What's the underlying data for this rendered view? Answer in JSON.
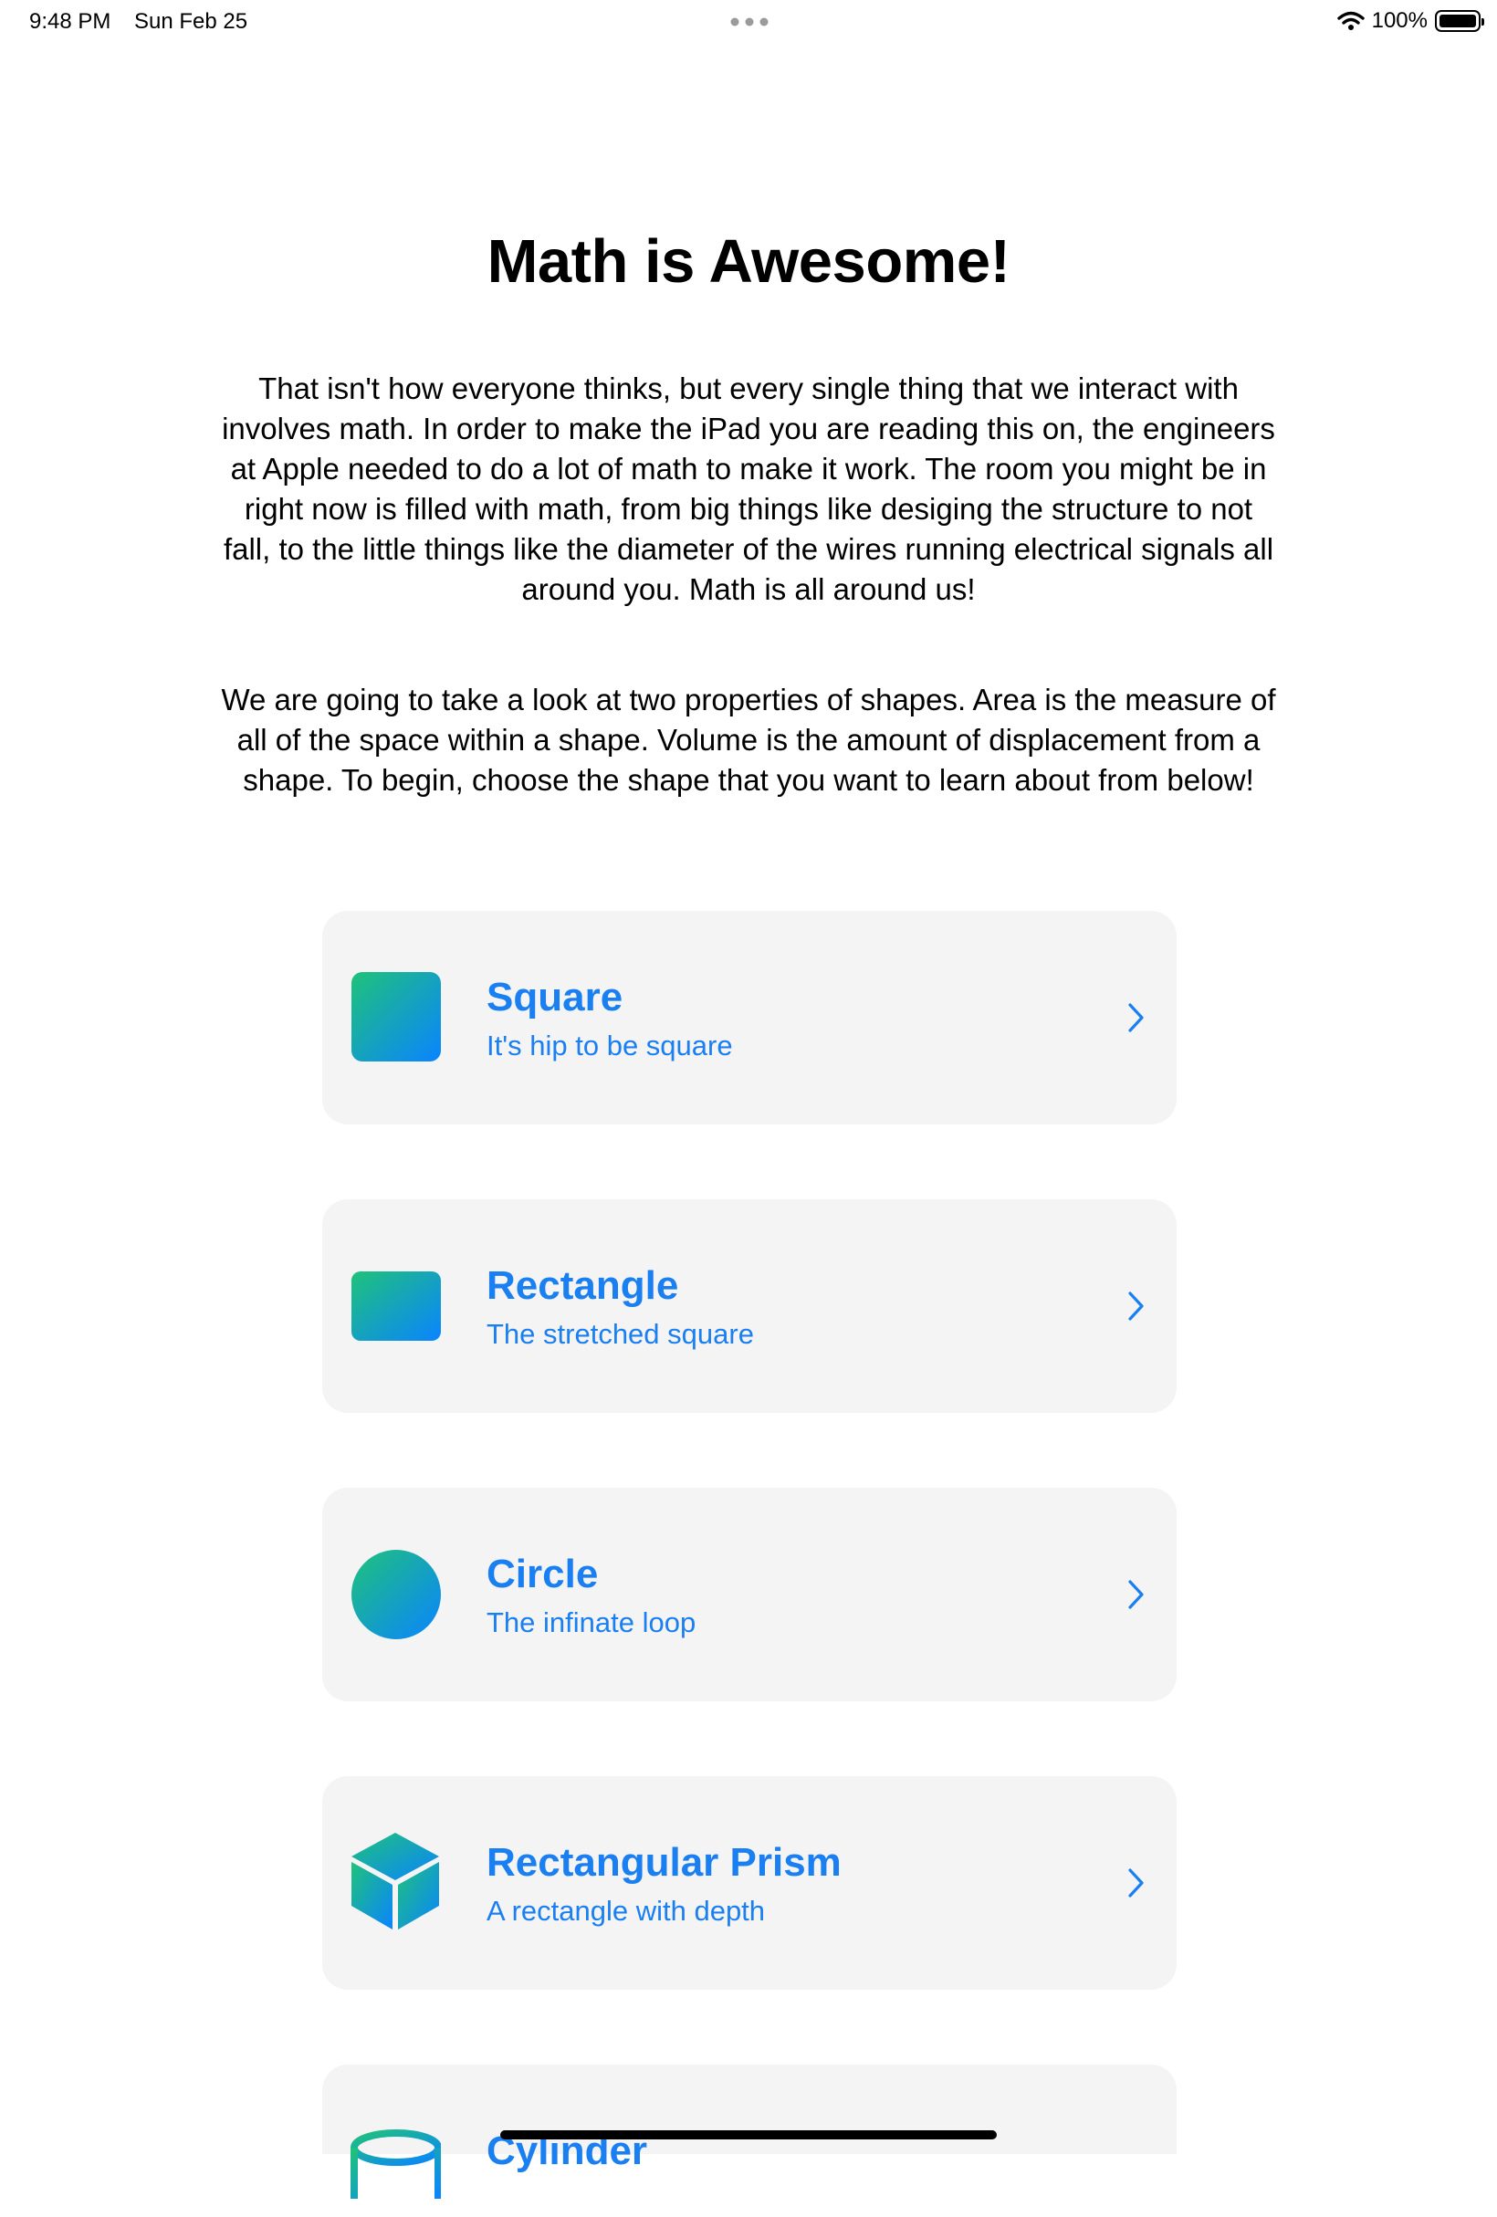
{
  "status_bar": {
    "time": "9:48 PM",
    "date": "Sun Feb 25",
    "battery": "100%"
  },
  "title": "Math is Awesome!",
  "intro": [
    "That isn't how everyone thinks, but every single thing that we interact with involves math. In order to make the iPad you are reading this on, the engineers at Apple needed to do a lot of math to make it work. The room you might be in right now is filled with math, from big things like desiging the structure to not fall, to the little things like the diameter of the wires running electrical signals all around you. Math is all around us!",
    "We are going to take a look at two properties of shapes. Area is the measure of all of the space within a shape. Volume is the amount of displacement from a shape. To begin, choose the shape that you want to learn about from below!"
  ],
  "shapes": [
    {
      "title": "Square",
      "subtitle": "It's hip to be square",
      "icon": "square-icon"
    },
    {
      "title": "Rectangle",
      "subtitle": "The stretched square",
      "icon": "rectangle-icon"
    },
    {
      "title": "Circle",
      "subtitle": "The infinate loop",
      "icon": "circle-icon"
    },
    {
      "title": "Rectangular Prism",
      "subtitle": "A rectangle with depth",
      "icon": "cube-icon"
    },
    {
      "title": "Cylinder",
      "subtitle": "",
      "icon": "cylinder-icon"
    }
  ],
  "colors": {
    "accent": "#1a7ff0",
    "gradient_start": "#1fc27a",
    "gradient_end": "#0a84ff",
    "card_background": "#f4f4f4"
  }
}
